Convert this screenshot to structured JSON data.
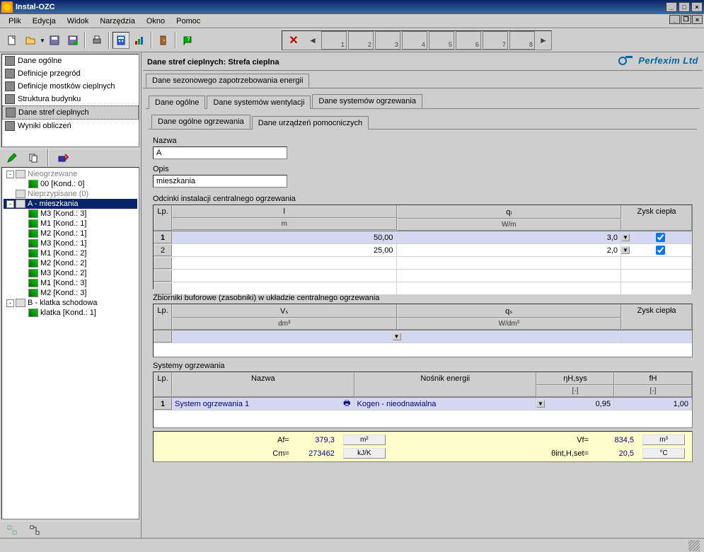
{
  "title": "Instal-OZC",
  "menu": [
    "Plik",
    "Edycja",
    "Widok",
    "Narzędzia",
    "Okno",
    "Pomoc"
  ],
  "nav_items": [
    {
      "label": "Dane ogólne",
      "icon": "page"
    },
    {
      "label": "Definicje przegród",
      "icon": "layers"
    },
    {
      "label": "Definicje mostków cieplnych",
      "icon": "bridge"
    },
    {
      "label": "Struktura budynku",
      "icon": "tree"
    },
    {
      "label": "Dane stref cieplnych",
      "icon": "zones",
      "selected": true
    },
    {
      "label": "Wyniki obliczeń",
      "icon": "calc"
    }
  ],
  "nav_numbers": [
    "1",
    "2",
    "3",
    "4",
    "5",
    "6",
    "7",
    "8"
  ],
  "tree": [
    {
      "label": "Nieogrzewane",
      "indent": 0,
      "toggle": "-",
      "gray": true
    },
    {
      "label": "00 [Kond.: 0]",
      "indent": 1
    },
    {
      "label": "Nieprzypisane (0)",
      "indent": 0,
      "gray": true
    },
    {
      "label": "A - mieszkania",
      "indent": 0,
      "toggle": "-",
      "selected": true
    },
    {
      "label": "M3 [Kond.: 3]",
      "indent": 1
    },
    {
      "label": "M1 [Kond.: 1]",
      "indent": 1
    },
    {
      "label": "M2 [Kond.: 1]",
      "indent": 1
    },
    {
      "label": "M3 [Kond.: 1]",
      "indent": 1
    },
    {
      "label": "M1 [Kond.: 2]",
      "indent": 1
    },
    {
      "label": "M2 [Kond.: 2]",
      "indent": 1
    },
    {
      "label": "M3 [Kond.: 2]",
      "indent": 1
    },
    {
      "label": "M1 [Kond.: 3]",
      "indent": 1
    },
    {
      "label": "M2 [Kond.: 3]",
      "indent": 1
    },
    {
      "label": "B - klatka schodowa",
      "indent": 0,
      "toggle": "-"
    },
    {
      "label": "klatka [Kond.: 1]",
      "indent": 1
    }
  ],
  "header": {
    "title": "Dane stref cieplnych: Strefa cieplna",
    "logo": "Perfexim Ltd"
  },
  "tabs_level1": {
    "items": [
      "Dane sezonowego zapotrzebowania energii"
    ],
    "active": 0
  },
  "tabs_level2": {
    "items": [
      "Dane ogólne",
      "Dane systemów wentylacji",
      "Dane systemów ogrzewania"
    ],
    "active": 2
  },
  "tabs_level3": {
    "items": [
      "Dane ogólne ogrzewania",
      "Dane urządzeń pomocniczych"
    ],
    "active": 0
  },
  "form": {
    "name_label": "Nazwa",
    "name_value": "A",
    "desc_label": "Opis",
    "desc_value": "mieszkania"
  },
  "grid1": {
    "title": "Odcinki instalacji centralnego ogrzewania",
    "cols": {
      "lp": "Lp.",
      "l": "l",
      "l_unit": "m",
      "ql": "qₗ",
      "ql_unit": "W/m",
      "zysk": "Zysk ciepła"
    },
    "rows": [
      {
        "lp": "1",
        "l": "50,00",
        "ql": "3,0",
        "zysk": true,
        "sel": true
      },
      {
        "lp": "2",
        "l": "25,00",
        "ql": "2,0",
        "zysk": true
      }
    ]
  },
  "grid2": {
    "title": "Zbiorniki buforowe (zasobniki) w układzie centralnego ogrzewania",
    "cols": {
      "lp": "Lp.",
      "vs": "Vₛ",
      "vs_unit": "dm³",
      "qs": "qₛ",
      "qs_unit": "W/dm³",
      "zysk": "Zysk ciepła"
    }
  },
  "grid3": {
    "title": "Systemy ogrzewania",
    "cols": {
      "lp": "Lp.",
      "nazwa": "Nazwa",
      "nosnik": "Nośnik energii",
      "eta": "ηH,sys",
      "eta_unit": "[-]",
      "fh": "fH",
      "fh_unit": "[-]"
    },
    "rows": [
      {
        "lp": "1",
        "nazwa": "System ogrzewania 1",
        "nosnik": "Kogen - nieodnawialna",
        "eta": "0,95",
        "fh": "1,00"
      }
    ]
  },
  "summary": {
    "af_label": "Af=",
    "af_val": "379,3",
    "af_unit": "m²",
    "vf_label": "Vf=",
    "vf_val": "834,5",
    "vf_unit": "m³",
    "cm_label": "Cm=",
    "cm_val": "273462",
    "cm_unit": "kJ/K",
    "theta_label": "θint,H,set=",
    "theta_val": "20,5",
    "theta_unit": "°C"
  }
}
